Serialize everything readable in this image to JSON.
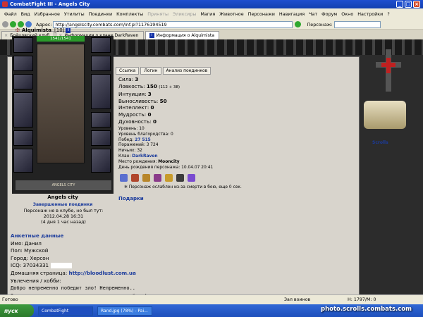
{
  "window": {
    "title": "CombatFight III - Angels City"
  },
  "menu": [
    "Файл",
    "Вид",
    "Избранное",
    "Утилиты",
    "Поединки",
    "Комплекты",
    "Приняты",
    "Эликсиры",
    "Магия",
    "Животное",
    "Персонажи",
    "Навигация",
    "Чат",
    "Форум",
    "Окно",
    "Настройки",
    "?"
  ],
  "address": {
    "label": "Адрес:",
    "url": "http://angelscity.combats.com/inf.pl?1176194519",
    "persona_label": "Персонаж:"
  },
  "tabs": [
    {
      "label": "Бойцовский клуб",
      "active": false
    },
    {
      "label": "Информация о клане DarkRaven",
      "active": false
    },
    {
      "label": "Информация о Alquimista",
      "active": true
    }
  ],
  "character": {
    "name": "Alquimista",
    "level": "[10]",
    "hp": "1541/1541",
    "city": "Angels city",
    "duels": "Завершенные поединки",
    "not_in_club": "Персонаж не в клубе, но был тут:",
    "last_seen": "2012.04.28 16:31",
    "ago": "(4 дня 1 час назад)",
    "logo_text": "ANGELS CITY"
  },
  "buttons": {
    "link": "Ссылка",
    "login": "Логин",
    "analysis": "Анализ поединков"
  },
  "stats": [
    {
      "label": "Сила:",
      "value": "3",
      "extra": ""
    },
    {
      "label": "Ловкость:",
      "value": "150",
      "extra": "(112 + 38)"
    },
    {
      "label": "Интуиция:",
      "value": "3",
      "extra": ""
    },
    {
      "label": "Выносливость:",
      "value": "50",
      "extra": ""
    },
    {
      "label": "Интеллект:",
      "value": "0",
      "extra": ""
    },
    {
      "label": "Мудрость:",
      "value": "0",
      "extra": ""
    },
    {
      "label": "Духовность:",
      "value": "0",
      "extra": ""
    }
  ],
  "info": {
    "level": "Уровень: 10",
    "blessing": "Уровень благородства: 0",
    "wins_label": "Побед:",
    "wins": "27 515",
    "losses": "Поражений: 3 724",
    "draws": "Ничьих: 32",
    "clan_label": "Клан:",
    "clan": "DarkRaven",
    "birthplace_label": "Место рождения:",
    "birthplace": "Mooncity",
    "birthday": "День рождения персонажа: 10.04.07 20:41"
  },
  "weakened": "Персонаж ослаблен из-за смерти в бою, еще 0 сек.",
  "gifts": "Подарки",
  "profile": {
    "title": "Анкетные данные",
    "name": "Имя: Данил",
    "gender": "Пол: Мужской",
    "city": "Город: Херсон",
    "icq": "ICQ: 37034331",
    "homepage_label": "Домашняя страница:",
    "homepage": "http://bloodlust.com.ua",
    "hobby": "Увлечения / хобби:",
    "quote1": "Добро непременно победит зло! Непременно..",
    "quote2": "Затем поставит его на колени, и зверски убьет!"
  },
  "scrolls": "Scrolls",
  "status": {
    "ready": "Готово",
    "hall": "Зал воинов",
    "hp": "Н: 1797/М: 0"
  },
  "taskbar": {
    "start": "пуск",
    "task1": "CombatFight",
    "task2": "Rand.jpg (78%) - Pai..."
  },
  "watermark": "photo.scrolls.combats.com"
}
